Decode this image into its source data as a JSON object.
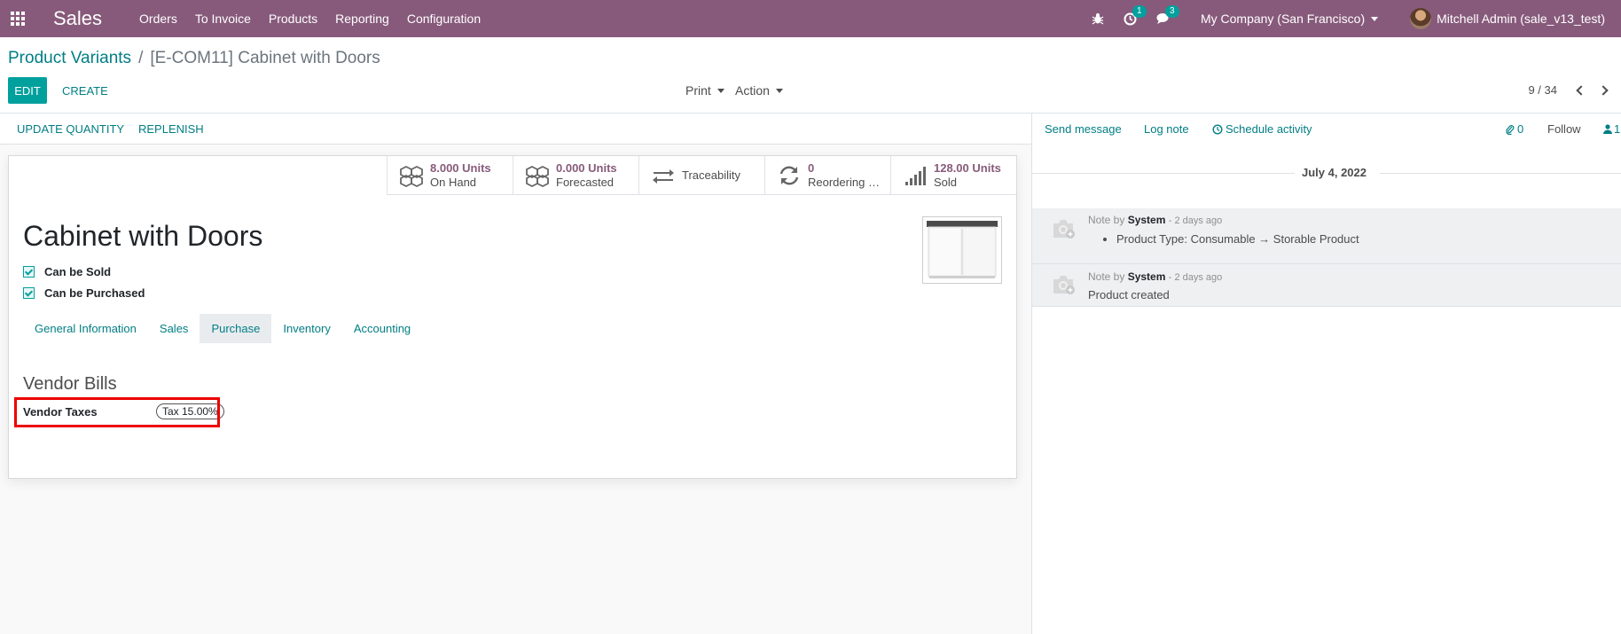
{
  "navbar": {
    "app_name": "Sales",
    "menu": [
      "Orders",
      "To Invoice",
      "Products",
      "Reporting",
      "Configuration"
    ],
    "activity_count": "1",
    "message_count": "3",
    "company": "My Company (San Francisco)",
    "user": "Mitchell Admin (sale_v13_test)",
    "icons": [
      "apps-grid-icon",
      "bug-icon",
      "clock-icon",
      "chat-icon"
    ]
  },
  "control": {
    "breadcrumb_parent": "Product Variants",
    "breadcrumb_current": "[E-COM11] Cabinet with Doors",
    "edit_label": "EDIT",
    "create_label": "CREATE",
    "print_label": "Print",
    "action_label": "Action",
    "pager": "9 / 34"
  },
  "statusbar": {
    "update_qty": "UPDATE QUANTITY",
    "replenish": "REPLENISH"
  },
  "smart_buttons": [
    {
      "value": "8.000 Units",
      "label": "On Hand",
      "icon": "cubes-icon"
    },
    {
      "value": "0.000 Units",
      "label": "Forecasted",
      "icon": "cubes-icon"
    },
    {
      "value": "",
      "label": "Traceability",
      "icon": "exchange-icon"
    },
    {
      "value": "0",
      "label": "Reordering R...",
      "icon": "refresh-icon"
    },
    {
      "value": "128.00 Units",
      "label": "Sold",
      "icon": "signal-icon"
    }
  ],
  "product": {
    "name": "Cabinet with Doors",
    "can_be_sold": "Can be Sold",
    "can_be_purchased": "Can be Purchased"
  },
  "tabs": [
    "General Information",
    "Sales",
    "Purchase",
    "Inventory",
    "Accounting"
  ],
  "active_tab": "Purchase",
  "purchase": {
    "section_title": "Vendor Bills",
    "vendor_taxes_label": "Vendor Taxes",
    "vendor_tax_tag": "Tax 15.00%"
  },
  "chatter": {
    "send_message": "Send message",
    "log_note": "Log note",
    "schedule_activity": "Schedule activity",
    "attachments": "0",
    "follow": "Follow",
    "followers": "1",
    "date": "July 4, 2022",
    "messages": [
      {
        "prefix": "Note by",
        "author": "System",
        "date": "- 2 days ago",
        "body": "Product Type: Consumable → Storable Product"
      },
      {
        "prefix": "Note by",
        "author": "System",
        "date": "- 2 days ago",
        "body": "Product created"
      }
    ]
  },
  "colors": {
    "navbar": "#875a7b",
    "primary": "#00a09d",
    "link": "#017e84",
    "highlight": "#ee0000"
  }
}
